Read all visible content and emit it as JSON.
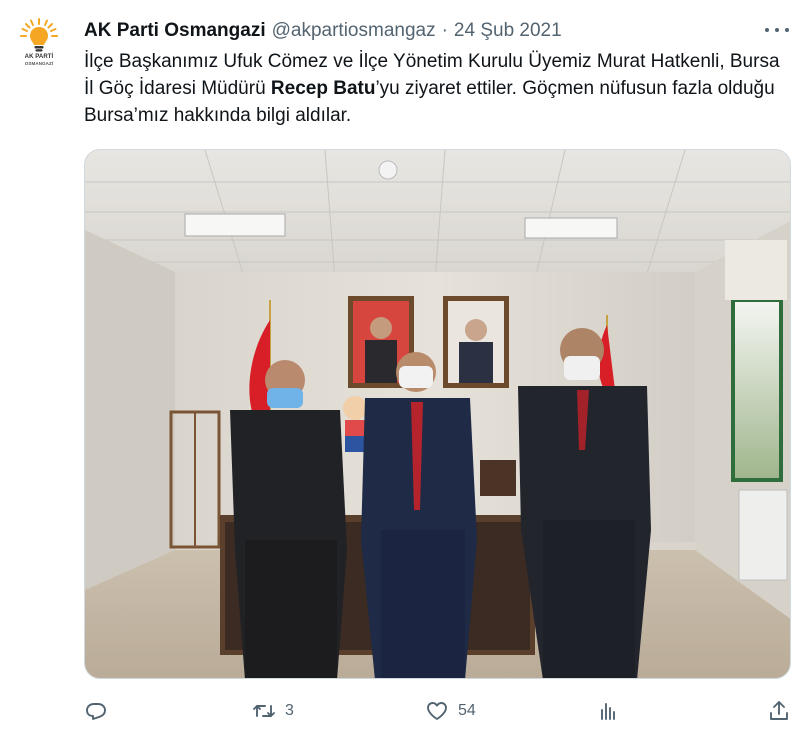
{
  "tweet": {
    "author_name": "AK Parti Osmangazi",
    "author_handle": "@akpartiosmangaz",
    "separator": "·",
    "date": "24 Şub 2021",
    "avatar_logo_text": "AK PARTİ",
    "avatar_logo_sub": "OSMANGAZİ",
    "text_part1": "İlçe Başkanımız Ufuk Cömez ve İlçe Yönetim Kurulu Üyemiz Murat Hatkenli, Bursa İl Göç İdaresi Müdürü ",
    "text_bold": "Recep Batu",
    "text_part2": "’yu ziyaret ettiler. Göçmen nüfusun fazla olduğu Bursa’mız hakkında bilgi aldılar."
  },
  "actions": {
    "reply_icon": "reply-icon",
    "retweet_icon": "retweet-icon",
    "retweet_count": "3",
    "like_icon": "heart-icon",
    "like_count": "54",
    "views_icon": "views-icon",
    "share_icon": "share-icon"
  },
  "colors": {
    "text_primary": "#0f1419",
    "text_secondary": "#536471",
    "border": "#cfd9de",
    "brand_orange": "#f5a623"
  }
}
